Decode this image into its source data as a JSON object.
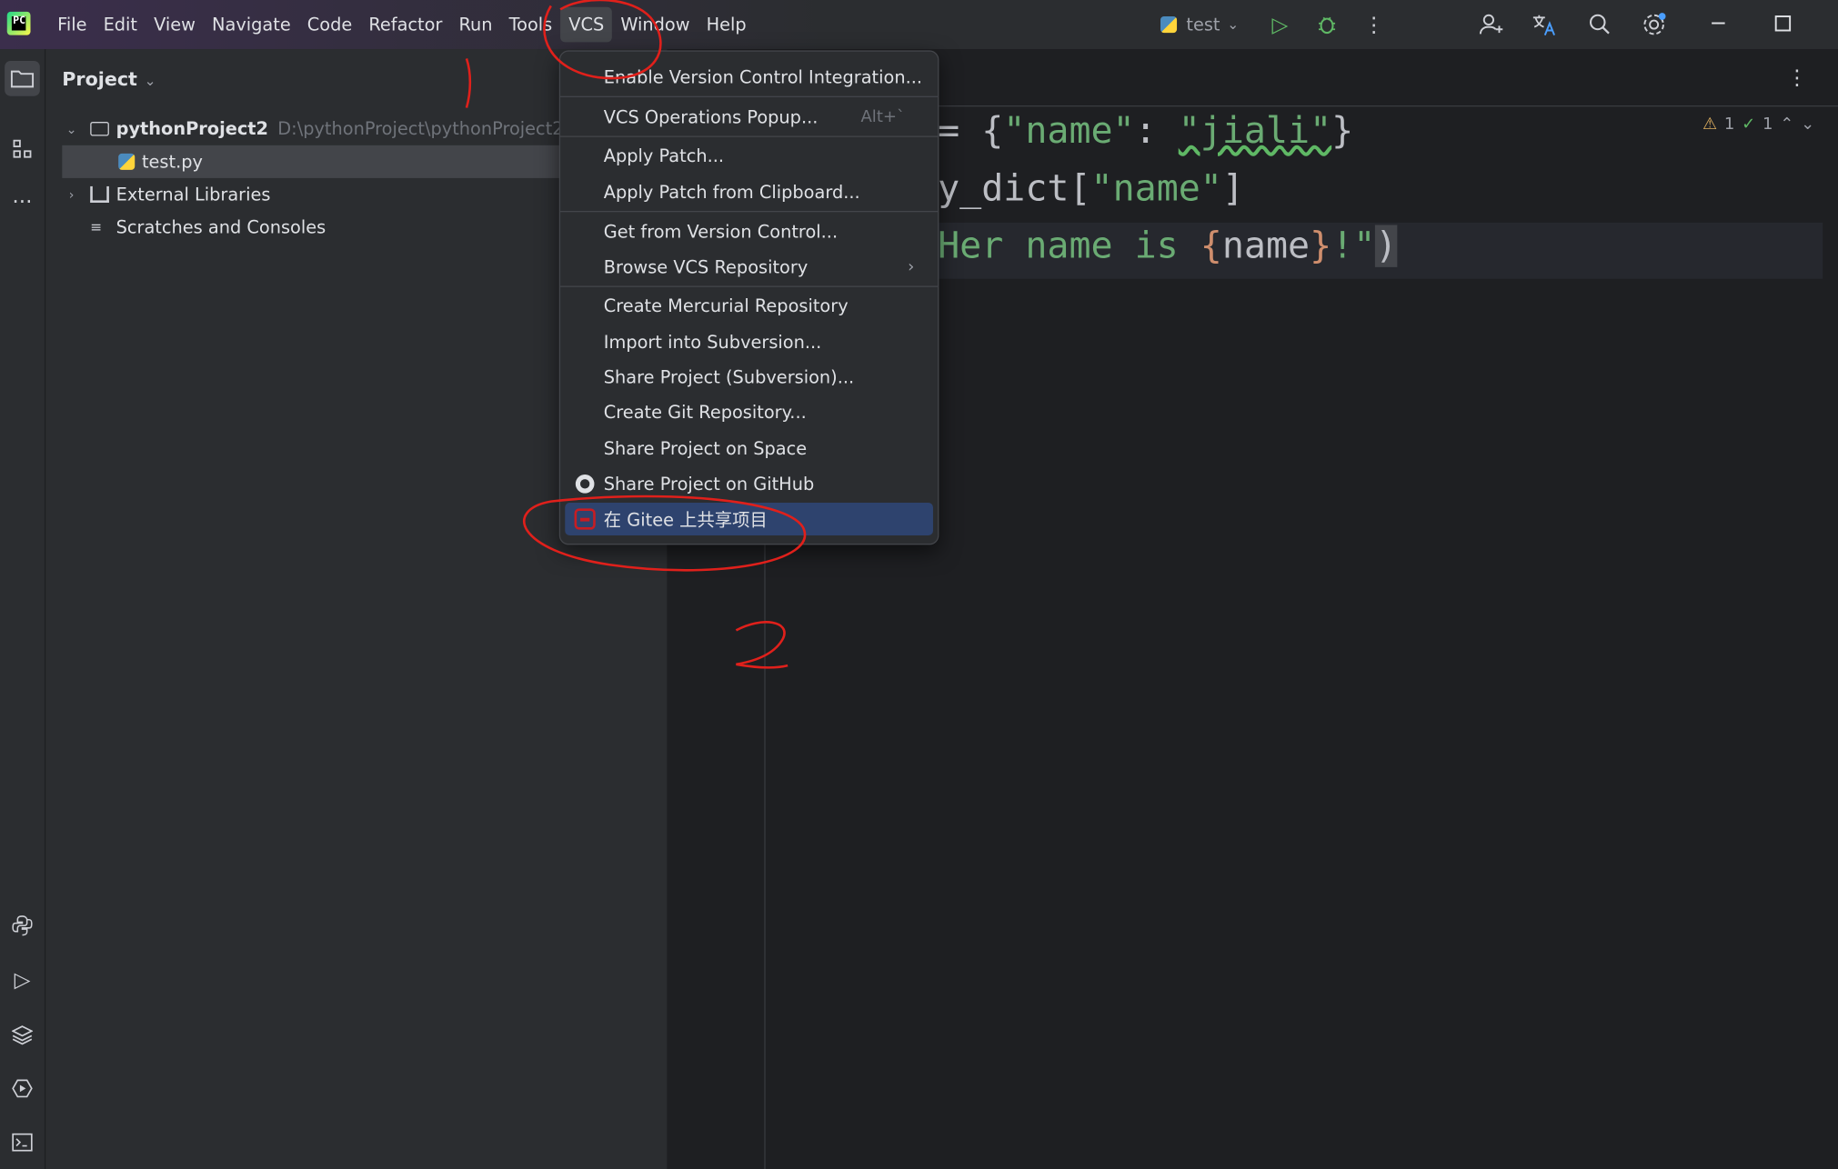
{
  "menubar": [
    "File",
    "Edit",
    "View",
    "Navigate",
    "Code",
    "Refactor",
    "Run",
    "Tools",
    "VCS",
    "Window",
    "Help"
  ],
  "active_menu": "VCS",
  "run_config": {
    "name": "test",
    "chevron": "⌄"
  },
  "project": {
    "header": "Project",
    "chevron": "⌄",
    "root": {
      "name": "pythonProject2",
      "path": "D:\\pythonProject\\pythonProject2"
    },
    "file": "test.py",
    "external": "External Libraries",
    "scratches": "Scratches and Consoles"
  },
  "editor": {
    "line1": {
      "op": "= ",
      "b1": "{",
      "k": "\"name\"",
      "colon": ": ",
      "v": "\"jiali\"",
      "b2": "}"
    },
    "line2": {
      "id": "y_dict[",
      "s": "\"name\"",
      "end": "]"
    },
    "line3": {
      "s1": "Her name is ",
      "b1": "{",
      "id": "name",
      "b2": "}",
      "s2": "!\"",
      "p": ")"
    },
    "inspections": {
      "warnings": "1",
      "weak": "1"
    }
  },
  "vcs_menu": {
    "items": [
      "Enable Version Control Integration...",
      "VCS Operations Popup...",
      "Apply Patch...",
      "Apply Patch from Clipboard...",
      "Get from Version Control...",
      "Browse VCS Repository",
      "Create Mercurial Repository",
      "Import into Subversion...",
      "Share Project (Subversion)...",
      "Create Git Repository...",
      "Share Project on Space",
      "Share Project on GitHub",
      "在 Gitee 上共享项目"
    ],
    "shortcut_ops_popup": "Alt+`",
    "submenu_arrow": "›",
    "highlighted": "在 Gitee 上共享项目"
  },
  "annotations": {
    "step1": "1",
    "step2": "2",
    "color": "#e0201b"
  },
  "colors": {
    "accent": "#2e436e",
    "string": "#6aab73",
    "brace": "#cf8e6d"
  }
}
